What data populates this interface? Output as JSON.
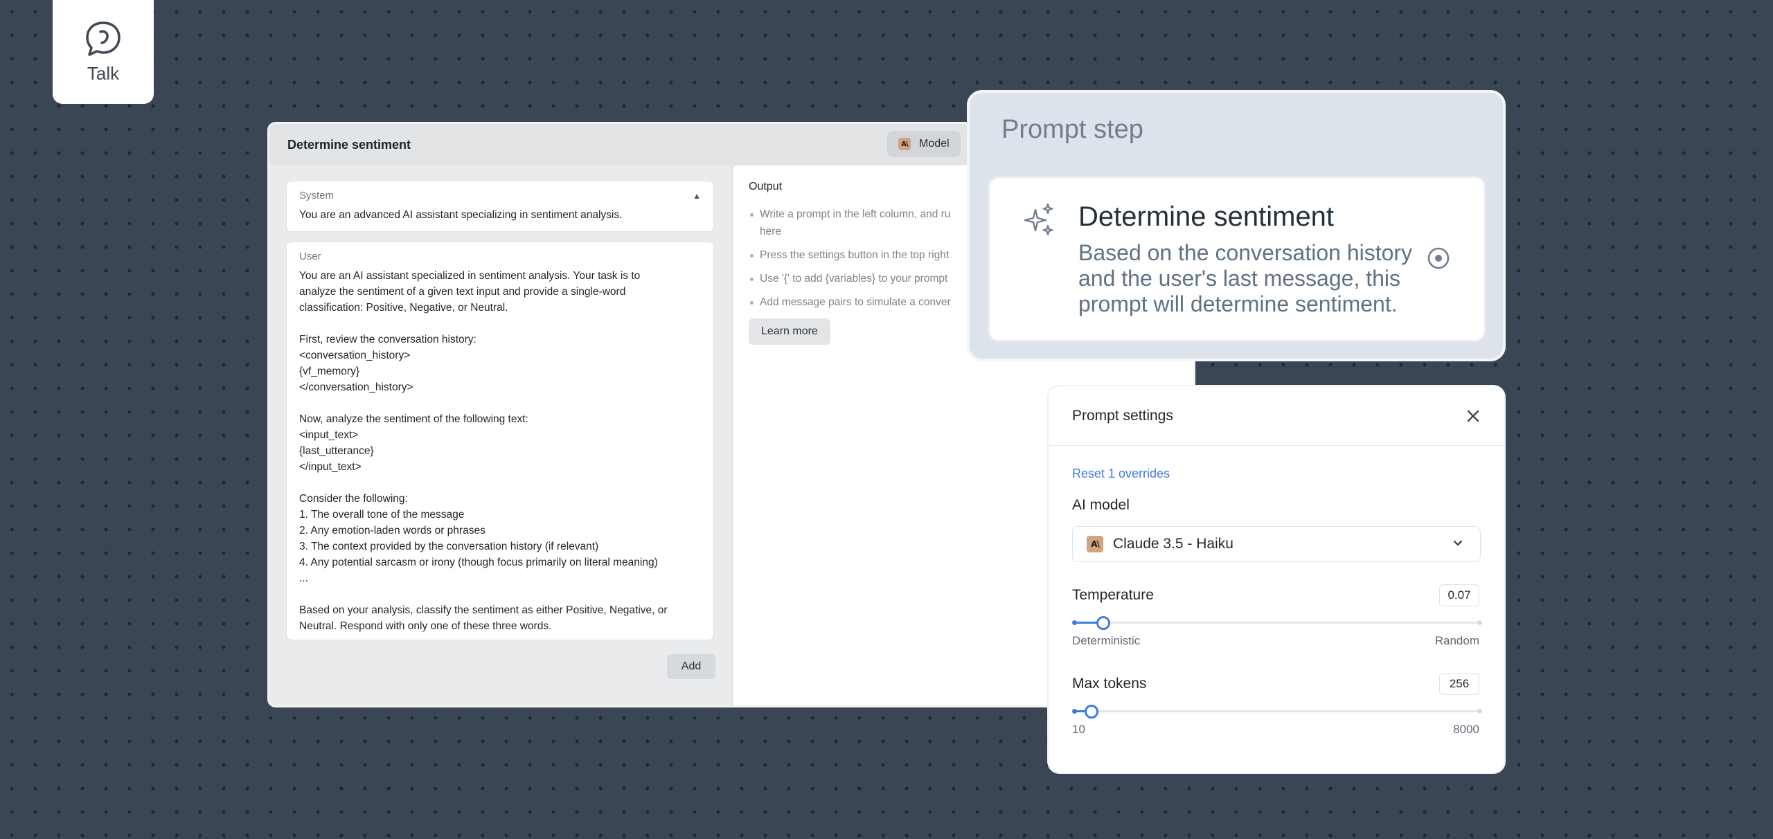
{
  "talk": {
    "label": "Talk",
    "icon": "chat-bubble-icon"
  },
  "editor": {
    "title": "Determine sentiment",
    "model_button": "Model",
    "system": {
      "role": "System",
      "text": "You are an advanced AI assistant specializing in sentiment analysis."
    },
    "user": {
      "role": "User",
      "text": "You are an AI assistant specialized in sentiment analysis. Your task is to\nanalyze the sentiment of a given text input and provide a single-word\nclassification: Positive, Negative, or Neutral.\n\nFirst, review the conversation history:\n<conversation_history>\n{vf_memory}\n</conversation_history>\n\nNow, analyze the sentiment of the following text:\n<input_text>\n{last_utterance}\n</input_text>\n\nConsider the following:\n1. The overall tone of the message\n2. Any emotion-laden words or phrases\n3. The context provided by the conversation history (if relevant)\n4. Any potential sarcasm or irony (though focus primarily on literal meaning)\n...\n\nBased on your analysis, classify the sentiment as either Positive, Negative, or\nNeutral. Respond with only one of these three words."
    },
    "add_button": "Add",
    "output": {
      "title": "Output",
      "items": [
        "Write a prompt in the left column, and ru\nhere",
        "Press the settings button in the top right",
        "Use '{' to add {variables} to your prompt",
        "Add message pairs to simulate a conver"
      ],
      "learn_more": "Learn more"
    }
  },
  "prompt_step": {
    "title": "Prompt step",
    "heading": "Determine sentiment",
    "description": "Based on the conversation history and the user's last message, this prompt will determine sentiment."
  },
  "settings": {
    "title": "Prompt settings",
    "reset_link": "Reset 1 overrides",
    "ai_model_label": "AI model",
    "ai_model_value": "Claude 3.5 - Haiku",
    "temperature": {
      "label": "Temperature",
      "value": "0.07",
      "fraction": 0.07,
      "min_label": "Deterministic",
      "max_label": "Random"
    },
    "max_tokens": {
      "label": "Max tokens",
      "value": "256",
      "fraction": 0.031,
      "min_label": "10",
      "max_label": "8000"
    },
    "accent_color": "#3c7de0"
  }
}
